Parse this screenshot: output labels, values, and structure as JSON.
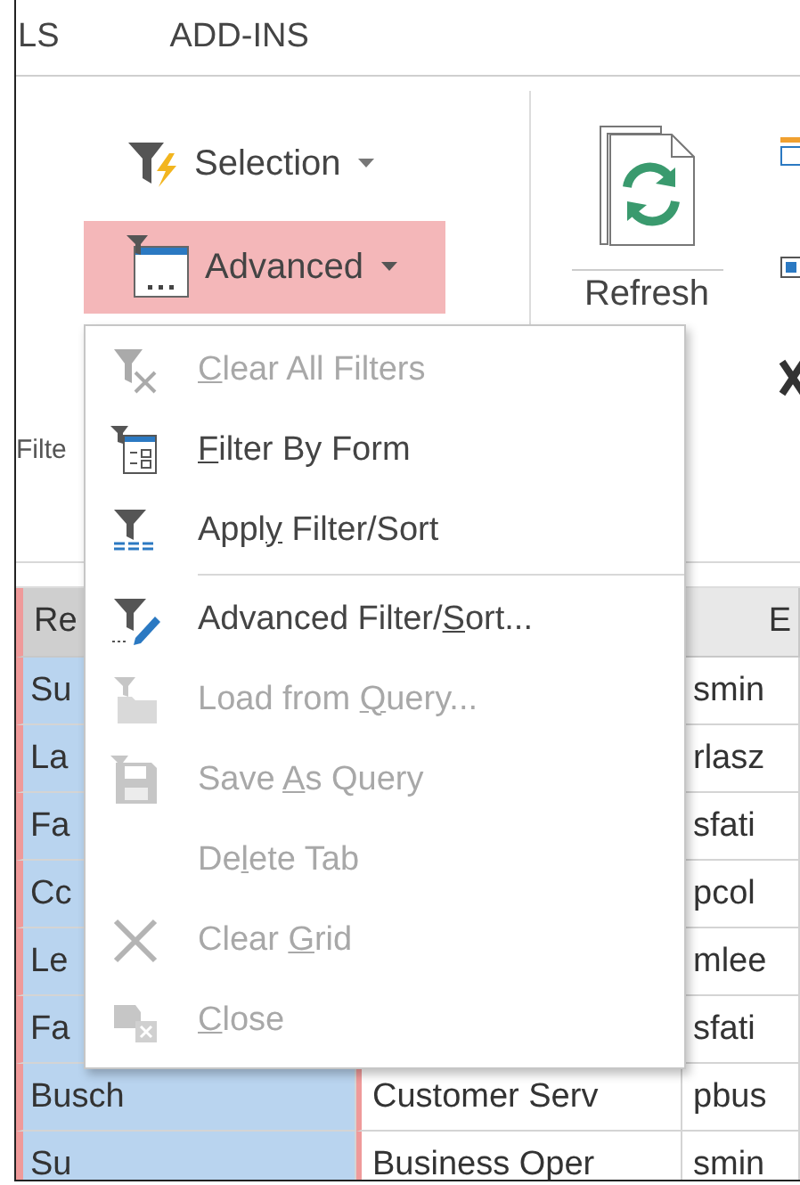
{
  "tabs": [
    {
      "label": "LS"
    },
    {
      "label": "ADD-INS"
    }
  ],
  "ribbon": {
    "selection_button": {
      "label": "Selection"
    },
    "advanced_button": {
      "label": "Advanced",
      "expanded": true
    },
    "refresh_button": {
      "label": "Refresh"
    },
    "group_label": "Filte"
  },
  "menu": {
    "items": [
      {
        "kind": "item",
        "key": "C",
        "post": "lear All Filters",
        "disabled": true
      },
      {
        "kind": "item",
        "key": "F",
        "post": "ilter By Form",
        "disabled": false
      },
      {
        "kind": "item",
        "pre": "Appl",
        "key": "y",
        "post": " Filter/Sort",
        "disabled": false
      },
      {
        "kind": "separator"
      },
      {
        "kind": "item",
        "pre": "Advanced Filter/",
        "key": "S",
        "post": "ort...",
        "disabled": false
      },
      {
        "kind": "item",
        "pre": "Load from ",
        "key": "Q",
        "post": "uery...",
        "disabled": true
      },
      {
        "kind": "item",
        "pre": "Save ",
        "key": "A",
        "post": "s Query",
        "disabled": true
      },
      {
        "kind": "item",
        "pre": "De",
        "key": "l",
        "post": "ete Tab",
        "disabled": true
      },
      {
        "kind": "item",
        "pre": "Clear ",
        "key": "G",
        "post": "rid",
        "disabled": true
      },
      {
        "kind": "item",
        "key": "C",
        "post": "lose",
        "disabled": true
      }
    ]
  },
  "table": {
    "columns": [
      {
        "label": "Re",
        "selected": true
      },
      {
        "label": "E",
        "selected": false
      }
    ],
    "rows": [
      {
        "column_1": "Su",
        "column_3": "smin"
      },
      {
        "column_1": "La",
        "column_3": "rlasz"
      },
      {
        "column_1": "Fa",
        "column_3": "sfati"
      },
      {
        "column_1": "Cc",
        "column_3": "pcol"
      },
      {
        "column_1": "Le",
        "column_3": "mlee"
      },
      {
        "column_1": "Fa",
        "column_3": "sfati"
      },
      {
        "column_1": "Busch",
        "column_2": "Customer Serv",
        "column_3": "pbus"
      },
      {
        "column_1": "Su",
        "column_2": "Business Oper",
        "column_3": "smin"
      }
    ]
  }
}
